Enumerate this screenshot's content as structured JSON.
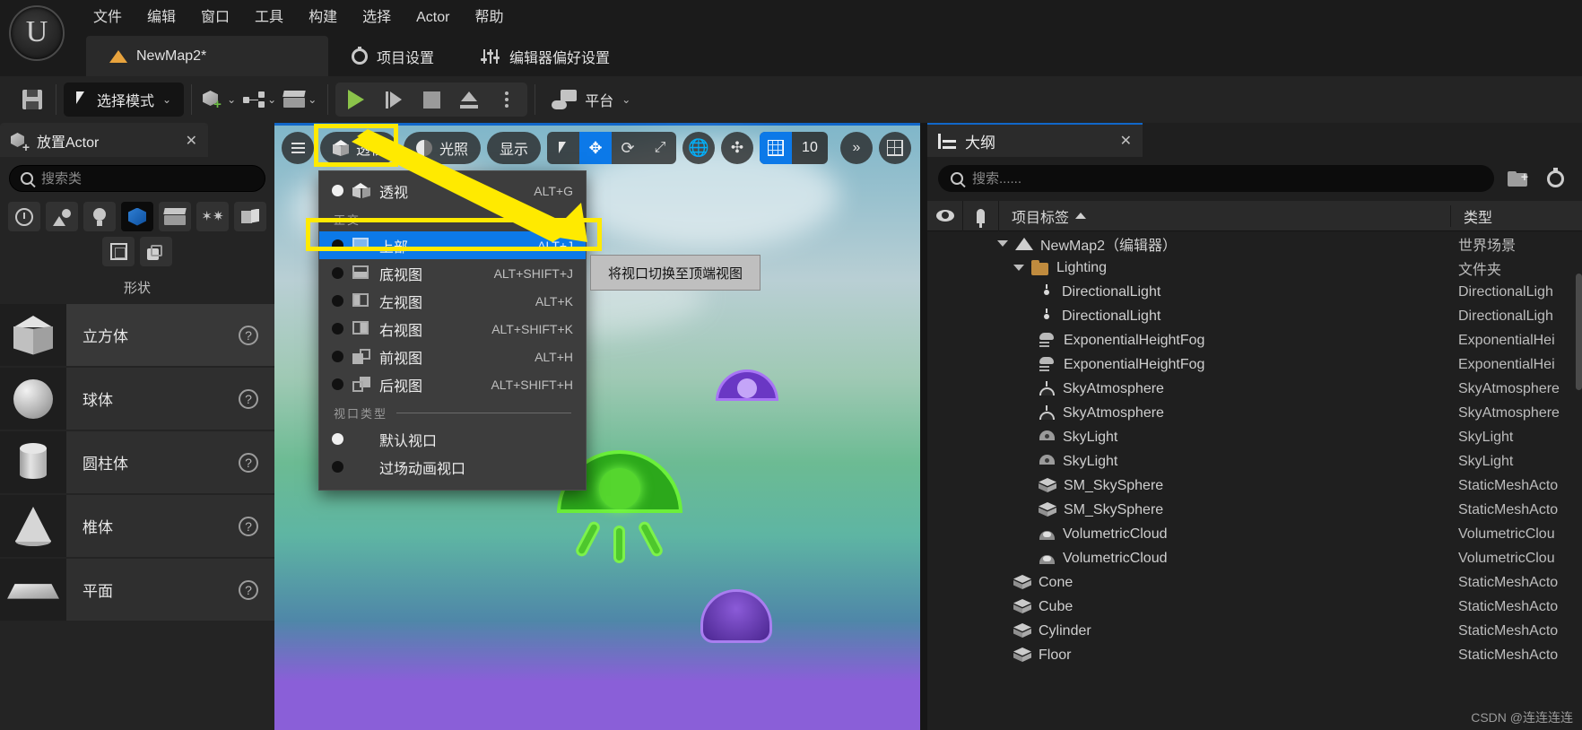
{
  "app": {
    "logo": "ue-logo",
    "menu": [
      "文件",
      "编辑",
      "窗口",
      "工具",
      "构建",
      "选择",
      "Actor",
      "帮助"
    ]
  },
  "tabs": [
    {
      "label": "NewMap2*",
      "icon": "map-icon",
      "active": true
    },
    {
      "label": "项目设置",
      "icon": "gear-icon",
      "active": false
    },
    {
      "label": "编辑器偏好设置",
      "icon": "sliders-icon",
      "active": false
    }
  ],
  "toolbar": {
    "save_label": "保存",
    "mode_label": "选择模式",
    "create_label": "创建",
    "blueprint_label": "蓝图",
    "cinematics_label": "过场动画",
    "play_label": "运行",
    "skip_label": "跳过",
    "stop_label": "停止",
    "eject_label": "弹出",
    "more_label": "更多选项",
    "platform_label": "平台"
  },
  "place_actor": {
    "tab_title": "放置Actor",
    "close": "✕",
    "search_placeholder": "搜索类",
    "categories": [
      {
        "name": "recently-placed",
        "icon": "clock-icon",
        "selected": false
      },
      {
        "name": "basic",
        "icon": "basic-icon",
        "selected": false
      },
      {
        "name": "lights",
        "icon": "bulb-icon",
        "selected": false
      },
      {
        "name": "shapes",
        "icon": "cube-icon",
        "selected": true
      },
      {
        "name": "cinematic",
        "icon": "clapper-icon",
        "selected": false
      },
      {
        "name": "visual-effects",
        "icon": "stars-icon",
        "selected": false
      },
      {
        "name": "geometry",
        "icon": "geometry-icon",
        "selected": false
      },
      {
        "name": "volumes",
        "icon": "volume-icon",
        "selected": false
      },
      {
        "name": "all-classes",
        "icon": "stack-icon",
        "selected": false
      }
    ],
    "section_label": "形状",
    "items": [
      {
        "name": "立方体",
        "icon": "cube-shape",
        "help": "?"
      },
      {
        "name": "球体",
        "icon": "sphere-shape",
        "help": "?"
      },
      {
        "name": "圆柱体",
        "icon": "cylinder-shape",
        "help": "?"
      },
      {
        "name": "椎体",
        "icon": "cone-shape",
        "help": "?"
      },
      {
        "name": "平面",
        "icon": "plane-shape",
        "help": "?"
      }
    ]
  },
  "viewport": {
    "menu_button": "hamburger-icon",
    "perspective_label": "透视",
    "lighting_label": "光照",
    "show_label": "显示",
    "grid_value": "10",
    "transform_tools": [
      {
        "name": "select-tool",
        "icon": "arrow-cursor-icon",
        "active": false
      },
      {
        "name": "move-tool",
        "icon": "move-icon",
        "active": true
      },
      {
        "name": "rotate-tool",
        "icon": "rotate-icon",
        "active": false
      },
      {
        "name": "scale-tool",
        "icon": "scale-icon",
        "active": false
      }
    ],
    "coord_label": "world-coordinate-icon",
    "snap_label": "surface-snap-icon",
    "expand_label": "»",
    "layout_label": "viewport-layout-icon"
  },
  "view_menu": {
    "perspective_group": [
      {
        "label": "透视",
        "shortcut": "ALT+G",
        "icon": "perspective-icon",
        "checked": true,
        "selected": false
      }
    ],
    "ortho_header": "正交",
    "ortho_items": [
      {
        "label": "上部",
        "shortcut": "ALT+J",
        "icon": "top-view-icon",
        "checked": false,
        "selected": true
      },
      {
        "label": "底视图",
        "shortcut": "ALT+SHIFT+J",
        "icon": "bottom-view-icon",
        "checked": false,
        "selected": false
      },
      {
        "label": "左视图",
        "shortcut": "ALT+K",
        "icon": "left-view-icon",
        "checked": false,
        "selected": false
      },
      {
        "label": "右视图",
        "shortcut": "ALT+SHIFT+K",
        "icon": "right-view-icon",
        "checked": false,
        "selected": false
      },
      {
        "label": "前视图",
        "shortcut": "ALT+H",
        "icon": "front-view-icon",
        "checked": false,
        "selected": false
      },
      {
        "label": "后视图",
        "shortcut": "ALT+SHIFT+H",
        "icon": "back-view-icon",
        "checked": false,
        "selected": false
      }
    ],
    "type_header": "视口类型",
    "type_items": [
      {
        "label": "默认视口",
        "shortcut": "",
        "checked": true,
        "selected": false
      },
      {
        "label": "过场动画视口",
        "shortcut": "",
        "checked": false,
        "selected": false
      }
    ]
  },
  "tooltip": {
    "text": "将视口切换至顶端视图"
  },
  "outliner": {
    "tab_title": "大纲",
    "close": "✕",
    "search_placeholder": "搜索......",
    "new_folder_label": "新建文件夹",
    "settings_label": "设置",
    "columns": {
      "visibility": "eye-icon",
      "pin": "pin-icon",
      "label": "项目标签",
      "sort": "▲",
      "type": "类型"
    },
    "rows": [
      {
        "label": "NewMap2（编辑器）",
        "type": "世界场景",
        "icon": "map-icon",
        "indent": 0,
        "expandable": true
      },
      {
        "label": "Lighting",
        "type": "文件夹",
        "icon": "folder-icon",
        "indent": 1,
        "expandable": true
      },
      {
        "label": "DirectionalLight",
        "type": "DirectionalLigh",
        "icon": "sun-icon",
        "indent": 2,
        "expandable": false
      },
      {
        "label": "DirectionalLight",
        "type": "DirectionalLigh",
        "icon": "sun-icon",
        "indent": 2,
        "expandable": false
      },
      {
        "label": "ExponentialHeightFog",
        "type": "ExponentialHei",
        "icon": "fog-icon",
        "indent": 2,
        "expandable": false
      },
      {
        "label": "ExponentialHeightFog",
        "type": "ExponentialHei",
        "icon": "fog-icon",
        "indent": 2,
        "expandable": false
      },
      {
        "label": "SkyAtmosphere",
        "type": "SkyAtmosphere",
        "icon": "atmosphere-icon",
        "indent": 2,
        "expandable": false
      },
      {
        "label": "SkyAtmosphere",
        "type": "SkyAtmosphere",
        "icon": "atmosphere-icon",
        "indent": 2,
        "expandable": false
      },
      {
        "label": "SkyLight",
        "type": "SkyLight",
        "icon": "skylight-icon",
        "indent": 2,
        "expandable": false
      },
      {
        "label": "SkyLight",
        "type": "SkyLight",
        "icon": "skylight-icon",
        "indent": 2,
        "expandable": false
      },
      {
        "label": "SM_SkySphere",
        "type": "StaticMeshActo",
        "icon": "mesh-icon",
        "indent": 2,
        "expandable": false
      },
      {
        "label": "SM_SkySphere",
        "type": "StaticMeshActo",
        "icon": "mesh-icon",
        "indent": 2,
        "expandable": false
      },
      {
        "label": "VolumetricCloud",
        "type": "VolumetricClou",
        "icon": "cloud-icon",
        "indent": 2,
        "expandable": false
      },
      {
        "label": "VolumetricCloud",
        "type": "VolumetricClou",
        "icon": "cloud-icon",
        "indent": 2,
        "expandable": false
      },
      {
        "label": "Cone",
        "type": "StaticMeshActo",
        "icon": "mesh-icon",
        "indent": 1,
        "expandable": false
      },
      {
        "label": "Cube",
        "type": "StaticMeshActo",
        "icon": "mesh-icon",
        "indent": 1,
        "expandable": false
      },
      {
        "label": "Cylinder",
        "type": "StaticMeshActo",
        "icon": "mesh-icon",
        "indent": 1,
        "expandable": false
      },
      {
        "label": "Floor",
        "type": "StaticMeshActo",
        "icon": "mesh-icon",
        "indent": 1,
        "expandable": false
      }
    ]
  },
  "watermark": "CSDN @连连连连",
  "colors": {
    "accent_blue": "#0c79e8",
    "highlight_yellow": "#ffea00",
    "panel_bg": "#242424",
    "outliner_bg": "#1f1f1f",
    "play_green": "#8bc34a"
  }
}
